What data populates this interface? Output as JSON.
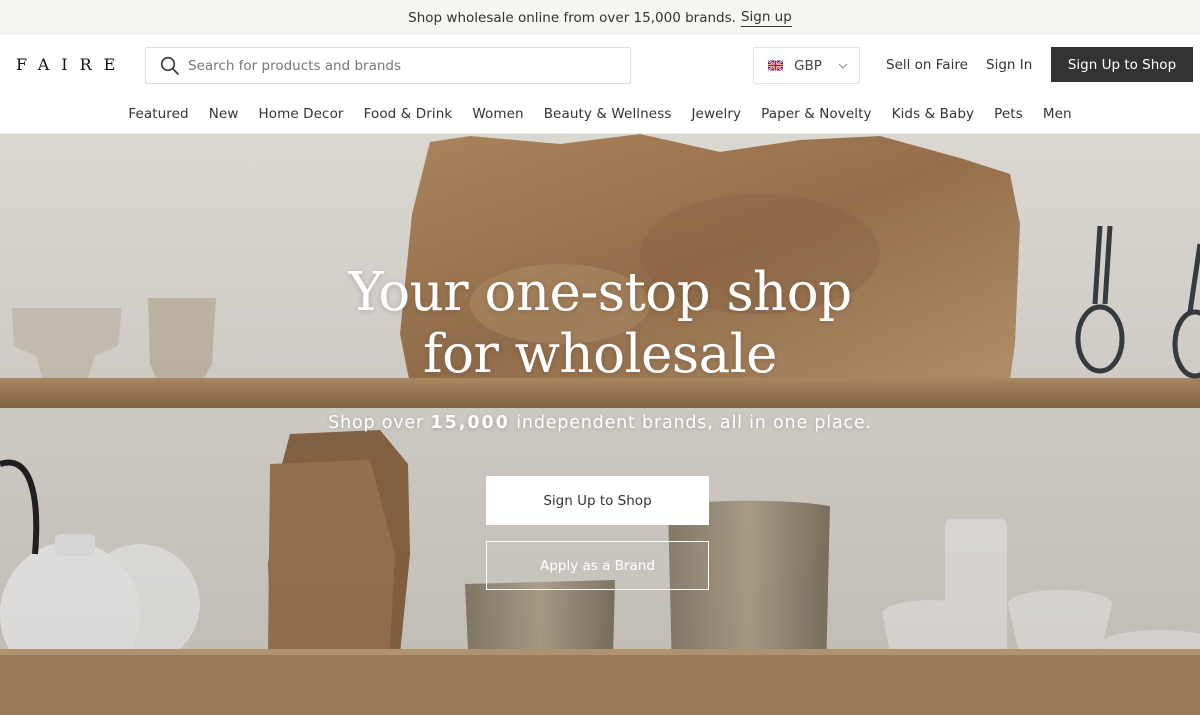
{
  "announcement": {
    "text": "Shop wholesale online from over 15,000 brands.",
    "link": "Sign up"
  },
  "header": {
    "logo": "FAIRE",
    "search_placeholder": "Search for products and brands",
    "currency": "GBP",
    "sell_link": "Sell on Faire",
    "signin_link": "Sign In",
    "signup_button": "Sign Up to Shop"
  },
  "nav": {
    "items": [
      "Featured",
      "New",
      "Home Decor",
      "Food & Drink",
      "Women",
      "Beauty & Wellness",
      "Jewelry",
      "Paper & Novelty",
      "Kids & Baby",
      "Pets",
      "Men"
    ]
  },
  "hero": {
    "title_line1": "Your one-stop shop",
    "title_line2": "for wholesale",
    "subtitle_before": "Shop over",
    "subtitle_count": "15,000",
    "subtitle_after": "independent brands, all in one place.",
    "primary_button": "Sign Up to Shop",
    "secondary_button": "Apply as a Brand"
  },
  "colors": {
    "dark_button": "#333333",
    "announce_bg": "#f7f5f2",
    "hero_wall": "#e9e6e1",
    "shelf_wood": "#a57a52"
  },
  "icons": {
    "search": "search-icon",
    "flag": "uk-flag-icon",
    "chevron": "chevron-down-icon"
  }
}
